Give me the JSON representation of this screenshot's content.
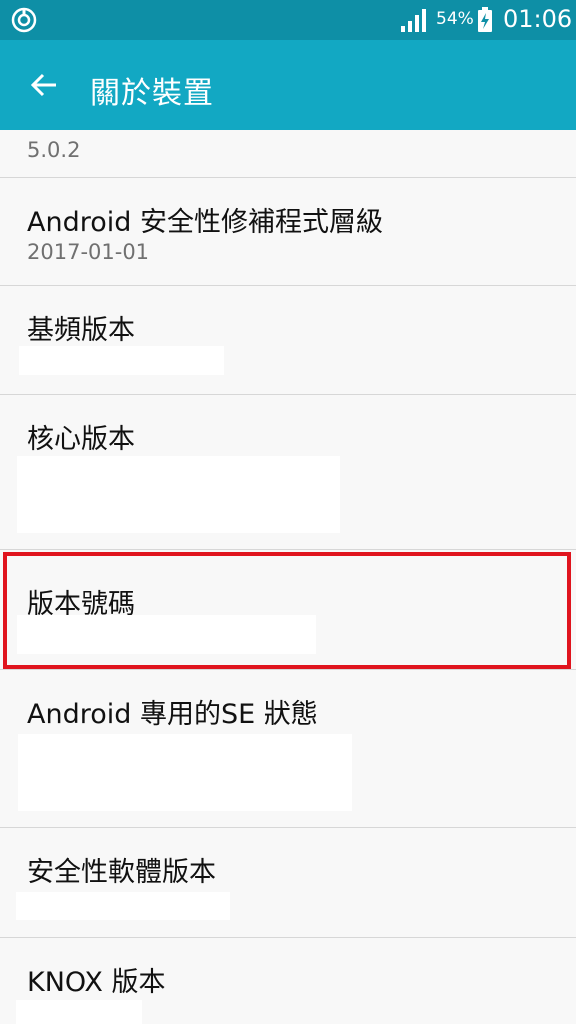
{
  "status_bar": {
    "battery_percent": "54%",
    "time": "01:06",
    "icons": [
      "sync-icon",
      "signal-icon",
      "battery-charging-icon"
    ]
  },
  "app_bar": {
    "title": "關於裝置",
    "back_icon": "arrow-left-icon"
  },
  "list": {
    "items": [
      {
        "subtitle": "5.0.2"
      },
      {
        "title": "Android 安全性修補程式層級",
        "subtitle": "2017-01-01"
      },
      {
        "title": "基頻版本"
      },
      {
        "title": "核心版本"
      },
      {
        "title": "版本號碼"
      },
      {
        "title": "Android 專用的SE 狀態"
      },
      {
        "title": "安全性軟體版本"
      },
      {
        "title": "KNOX 版本"
      }
    ]
  },
  "colors": {
    "status_bar": "#0e8fa6",
    "app_bar": "#12a8c3",
    "highlight": "#e0141e",
    "background": "#f8f8f8"
  }
}
